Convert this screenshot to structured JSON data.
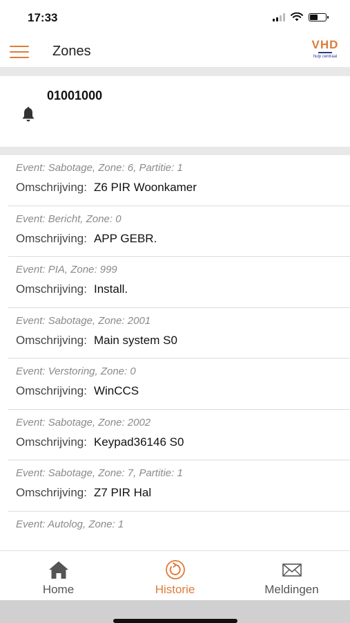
{
  "status": {
    "time": "17:33"
  },
  "header": {
    "title": "Zones",
    "logo_text": "VHD",
    "logo_sub": "hulp centraal"
  },
  "device": {
    "id": "01001000"
  },
  "events": [
    {
      "event": "Event: Sabotage, Zone: 6, Partitie: 1",
      "label": "Omschrijving:",
      "value": "Z6 PIR Woonkamer"
    },
    {
      "event": "Event: Bericht, Zone: 0",
      "label": "Omschrijving:",
      "value": "APP GEBR."
    },
    {
      "event": "Event: PIA, Zone: 999",
      "label": "Omschrijving:",
      "value": "Install."
    },
    {
      "event": "Event: Sabotage, Zone: 2001",
      "label": "Omschrijving:",
      "value": "Main system S0"
    },
    {
      "event": "Event: Verstoring, Zone: 0",
      "label": "Omschrijving:",
      "value": "WinCCS"
    },
    {
      "event": "Event: Sabotage, Zone: 2002",
      "label": "Omschrijving:",
      "value": "Keypad36146 S0"
    },
    {
      "event": "Event: Sabotage, Zone: 7, Partitie: 1",
      "label": "Omschrijving:",
      "value": "Z7 PIR Hal"
    },
    {
      "event": "Event: Autolog, Zone: 1",
      "label": "",
      "value": ""
    }
  ],
  "tabs": [
    {
      "label": "Home",
      "icon": "home-icon"
    },
    {
      "label": "Historie",
      "icon": "history-icon",
      "active": true
    },
    {
      "label": "Meldingen",
      "icon": "envelope-icon"
    }
  ],
  "colors": {
    "accent": "#e07b39",
    "logo_blue": "#2a3a8c"
  }
}
